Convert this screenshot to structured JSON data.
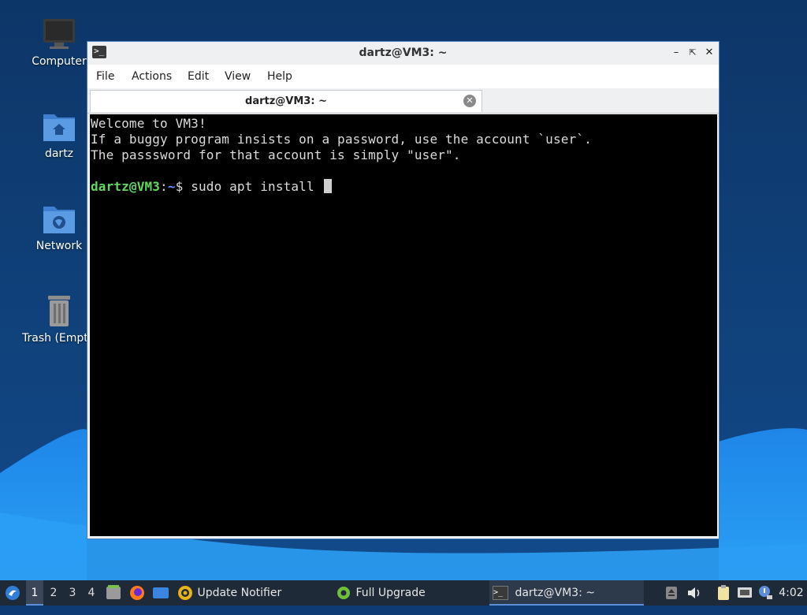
{
  "desktop": {
    "icons": [
      {
        "label": "Computer",
        "icon": "computer-icon"
      },
      {
        "label": "dartz",
        "icon": "home-folder-icon"
      },
      {
        "label": "Network",
        "icon": "network-folder-icon"
      },
      {
        "label": "Trash (Empt",
        "icon": "trash-icon"
      }
    ],
    "colors": {
      "background": "#0e3b73",
      "wave": "#1c7fe0"
    }
  },
  "window": {
    "title": "dartz@VM3: ~",
    "menu": [
      "File",
      "Actions",
      "Edit",
      "View",
      "Help"
    ],
    "tab_label": "dartz@VM3: ~",
    "terminal": {
      "lines": [
        "Welcome to VM3!",
        "If a buggy program insists on a password, use the account `user`.",
        "The passsword for that account is simply \"user\"."
      ],
      "prompt_user": "dartz@VM3",
      "prompt_sep": ":",
      "prompt_path": "~",
      "prompt_sym": "$",
      "command": " sudo apt install "
    }
  },
  "taskbar": {
    "workspaces": [
      "1",
      "2",
      "3",
      "4"
    ],
    "active_workspace": "1",
    "tasks": [
      {
        "label": "Update Notifier",
        "icon": "update-notifier-icon"
      },
      {
        "label": "Full Upgrade",
        "icon": "gear-icon"
      },
      {
        "label": "dartz@VM3: ~",
        "icon": "terminal-icon"
      }
    ],
    "clock": "4:02"
  }
}
